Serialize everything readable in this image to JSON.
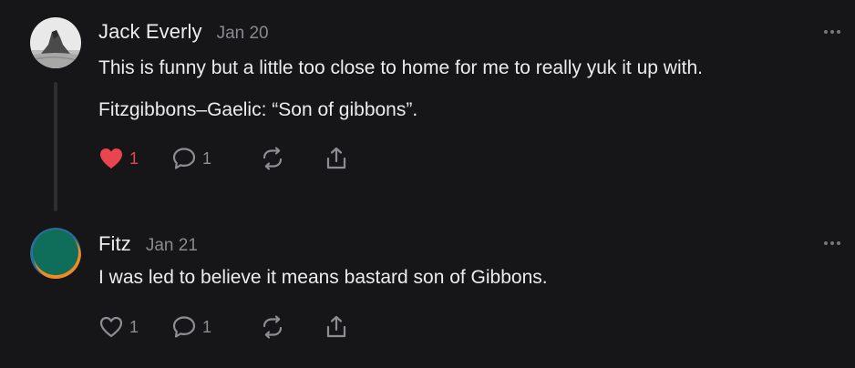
{
  "comments": [
    {
      "author": "Jack Everly",
      "date": "Jan 20",
      "paragraphs": [
        "This is funny but a little too close to home for me to really yuk it up with.",
        "Fitzgibbons–Gaelic: “Son of gibbons”."
      ],
      "likes": "1",
      "replies": "1",
      "liked": true,
      "avatar_icon": "rock-landscape-avatar"
    },
    {
      "author": "Fitz",
      "date": "Jan 21",
      "paragraphs": [
        "I was led to believe it means bastard son of Gibbons."
      ],
      "likes": "1",
      "replies": "1",
      "liked": false,
      "avatar_icon": "green-orange-avatar"
    }
  ],
  "colors": {
    "background": "#161618",
    "like_active": "#e8454f",
    "muted": "#8e8e92",
    "thread_line": "#2e2e31"
  }
}
